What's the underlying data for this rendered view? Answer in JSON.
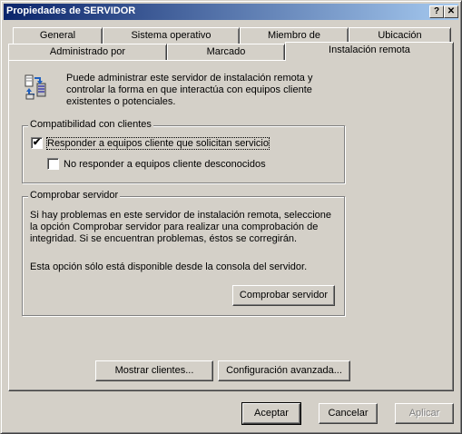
{
  "window": {
    "title": "Propiedades de SERVIDOR",
    "help_button": "?",
    "close_button": "✕"
  },
  "tabs": {
    "row_back": [
      {
        "label": "General"
      },
      {
        "label": "Sistema operativo"
      },
      {
        "label": "Miembro de"
      },
      {
        "label": "Ubicación"
      }
    ],
    "row_front": [
      {
        "label": "Administrado por"
      },
      {
        "label": "Marcado"
      },
      {
        "label": "Instalación remota"
      }
    ],
    "active": "Instalación remota"
  },
  "intro_text": "Puede administrar este servidor de instalación remota y controlar la forma en que interactúa con equipos cliente existentes o potenciales.",
  "compat_group": {
    "label": "Compatibilidad con clientes",
    "respond_label": "Responder a equipos cliente que solicitan servicio",
    "respond_checked": "✔",
    "no_respond_label": "No responder a equipos cliente desconocidos",
    "no_respond_checked": ""
  },
  "check_group": {
    "label": "Comprobar servidor",
    "description": "Si hay problemas en este servidor de instalación remota, seleccione la opción Comprobar servidor para realizar una comprobación de integridad. Si se encuentran problemas, éstos se corregirán.",
    "availability": "Esta opción sólo está disponible desde la consola del servidor.",
    "button": "Comprobar servidor"
  },
  "buttons": {
    "show_clients": "Mostrar clientes...",
    "advanced": "Configuración avanzada...",
    "ok": "Aceptar",
    "cancel": "Cancelar",
    "apply": "Aplicar"
  }
}
